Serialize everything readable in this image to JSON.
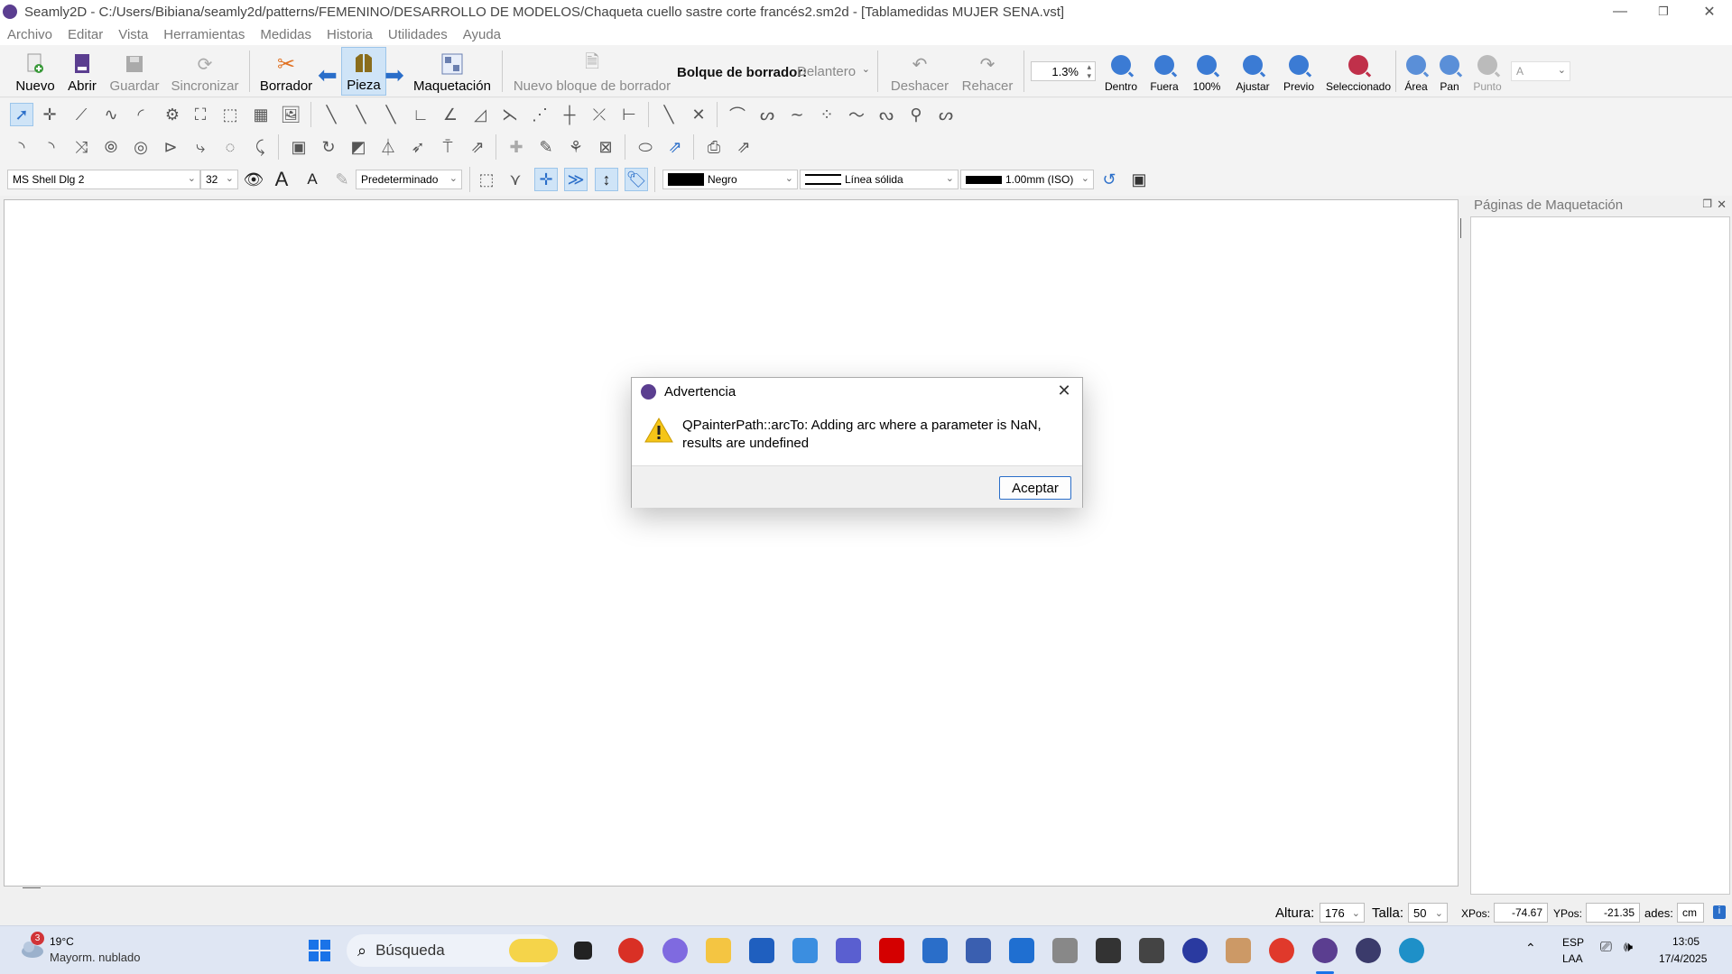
{
  "window": {
    "title": "Seamly2D - C:/Users/Bibiana/seamly2d/patterns/FEMENINO/DESARROLLO DE MODELOS/Chaqueta cuello sastre corte francés2.sm2d - [Tablamedidas MUJER SENA.vst]",
    "minimize": "—",
    "restore": "❐",
    "close": "✕"
  },
  "menu": [
    "Archivo",
    "Editar",
    "Vista",
    "Herramientas",
    "Medidas",
    "Historia",
    "Utilidades",
    "Ayuda"
  ],
  "toolbar": {
    "nuevo": "Nuevo",
    "abrir": "Abrir",
    "guardar": "Guardar",
    "sincronizar": "Sincronizar",
    "borrador": "Borrador",
    "pieza": "Pieza",
    "maquetacion": "Maquetación",
    "nuevo_bloque": "Nuevo bloque de borrador",
    "bloque_label": "Bolque de borrador:",
    "bloque_value": "Delantero",
    "deshacer": "Deshacer",
    "rehacer": "Rehacer",
    "zoom_value": "1.3%",
    "dentro": "Dentro",
    "fuera": "Fuera",
    "cien": "100%",
    "ajustar": "Ajustar",
    "previo": "Previo",
    "seleccionado": "Seleccionado",
    "area": "Área",
    "pan": "Pan",
    "punto": "Punto",
    "punto_combo": "A"
  },
  "format_bar": {
    "font": "MS Shell Dlg 2",
    "size": "32",
    "text_a1": "A",
    "text_a2": "A",
    "style": "Predeterminado",
    "color": "Negro",
    "line_type": "Línea sólida",
    "line_weight": "1.00mm (ISO)"
  },
  "right_panel": {
    "title": "Páginas de Maquetación"
  },
  "dialog": {
    "title": "Advertencia",
    "message": "QPainterPath::arcTo: Adding arc where a parameter is NaN, results are undefined",
    "ok": "Aceptar"
  },
  "status": {
    "altura_label": "Altura:",
    "altura_value": "176",
    "talla_label": "Talla:",
    "talla_value": "50",
    "xpos_label": "XPos:",
    "xpos_value": "-74.67",
    "ypos_label": "YPos:",
    "ypos_value": "-21.35",
    "units_label": "ades:",
    "units_value": "cm"
  },
  "taskbar": {
    "weather_badge": "3",
    "weather_temp": "19°C",
    "weather_desc": "Mayorm. nublado",
    "search": "Búsqueda",
    "lang1": "ESP",
    "lang2": "LAA",
    "time": "13:05",
    "date": "17/4/2025"
  },
  "colors": {
    "accent": "#2a6ec9",
    "brand": "#5b3e90",
    "zoom_icon": "#3b7bd4",
    "selected_zoom": "#c0304a"
  }
}
